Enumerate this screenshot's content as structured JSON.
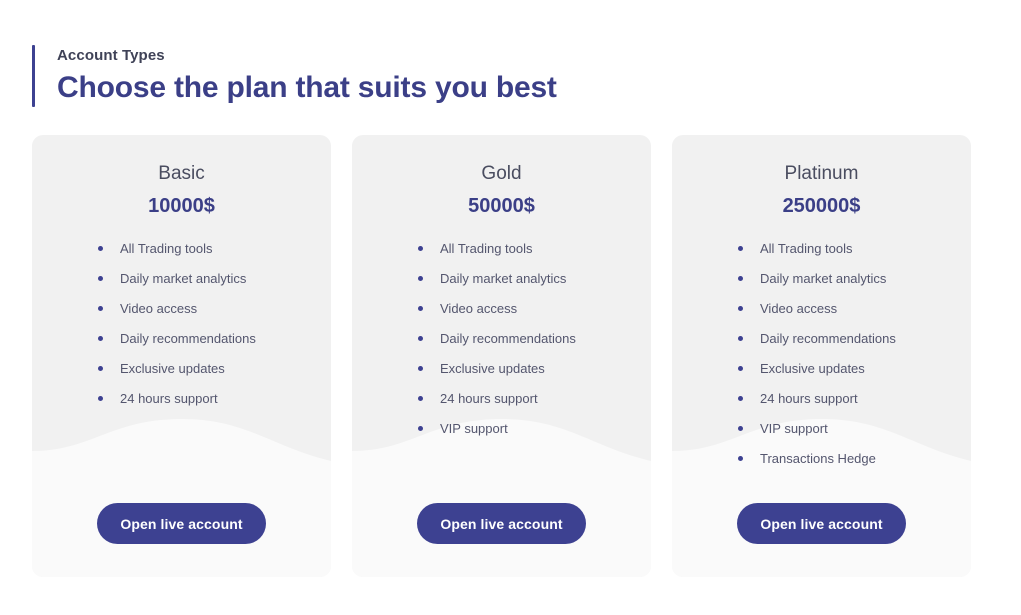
{
  "header": {
    "eyebrow": "Account Types",
    "headline": "Choose the plan that suits you best",
    "accent_color": "#3d4191"
  },
  "theme": {
    "page_background": "#ffffff",
    "card_background": "#f1f1f1",
    "card_wave_color": "#fafafa",
    "brand_indigo": "#3d4191",
    "headline_color": "#3b3f87",
    "feature_text_color": "#54566e",
    "plan_name_color": "#4a4d60",
    "button_text_color": "#ffffff"
  },
  "plans": [
    {
      "name": "Basic",
      "price": "10000$",
      "features": [
        "All Trading tools",
        "Daily market analytics",
        "Video access",
        "Daily recommendations",
        "Exclusive updates",
        "24 hours support"
      ],
      "cta_label": "Open live account"
    },
    {
      "name": "Gold",
      "price": "50000$",
      "features": [
        "All Trading tools",
        "Daily market analytics",
        "Video access",
        "Daily recommendations",
        "Exclusive updates",
        "24 hours support",
        "VIP support"
      ],
      "cta_label": "Open live account"
    },
    {
      "name": "Platinum",
      "price": "250000$",
      "features": [
        "All Trading tools",
        "Daily market analytics",
        "Video access",
        "Daily recommendations",
        "Exclusive updates",
        "24 hours support",
        "VIP support",
        "Transactions Hedge"
      ],
      "cta_label": "Open live account"
    }
  ]
}
